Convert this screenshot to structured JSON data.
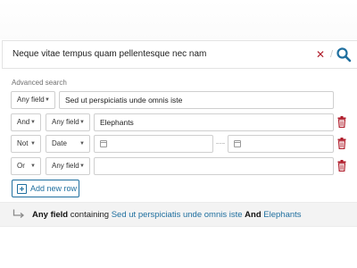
{
  "search": {
    "query": "Neque vitae tempus quam pellentesque nec nam"
  },
  "advanced": {
    "title": "Advanced search",
    "rows": [
      {
        "field": "Any field",
        "value": "Sed ut perspiciatis unde omnis iste"
      },
      {
        "operator": "And",
        "field": "Any field",
        "value": "Elephants"
      },
      {
        "operator": "Not",
        "field": "Date",
        "from": "",
        "to": ""
      },
      {
        "operator": "Or",
        "field": "Any field",
        "value": ""
      }
    ],
    "add_row_label": "Add new row"
  },
  "summary": {
    "field": "Any field",
    "connector": "containing",
    "value1": "Sed ut perspiciatis unde omnis iste",
    "operator": "And",
    "value2": "Elephants"
  },
  "colors": {
    "accent": "#1f6f9f",
    "danger": "#b01e2c"
  },
  "icons": [
    "clear-icon",
    "search-icon",
    "chevron-down-icon",
    "calendar-icon",
    "trash-icon",
    "plus-square-icon",
    "return-arrow-icon"
  ]
}
